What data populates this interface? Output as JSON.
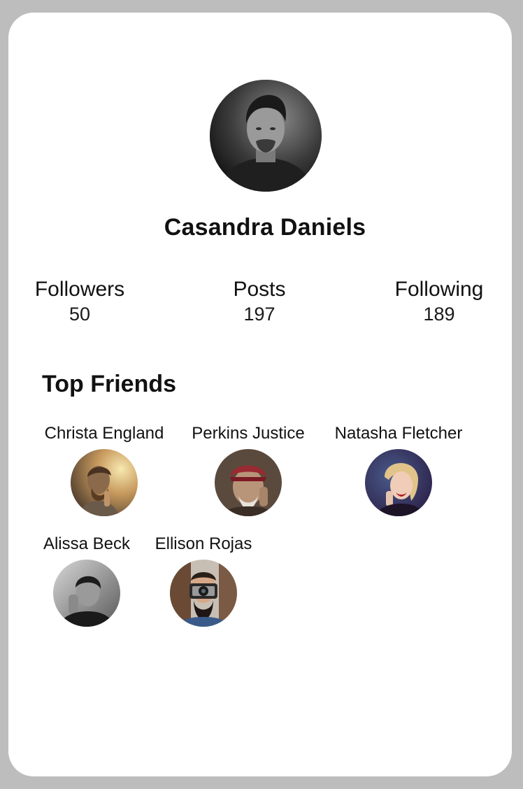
{
  "profile": {
    "name": "Casandra Daniels",
    "avatar_icon": "portrait-photo"
  },
  "stats": {
    "followers": {
      "label": "Followers",
      "value": "50"
    },
    "posts": {
      "label": "Posts",
      "value": "197"
    },
    "following": {
      "label": "Following",
      "value": "189"
    }
  },
  "top_friends": {
    "title": "Top Friends",
    "items": [
      {
        "name": "Christa England"
      },
      {
        "name": "Perkins Justice"
      },
      {
        "name": "Natasha Fletcher"
      },
      {
        "name": "Alissa Beck"
      },
      {
        "name": "Ellison Rojas"
      }
    ]
  },
  "colors": {
    "background": "#bdbdbd",
    "card": "#ffffff",
    "text": "#111111"
  }
}
